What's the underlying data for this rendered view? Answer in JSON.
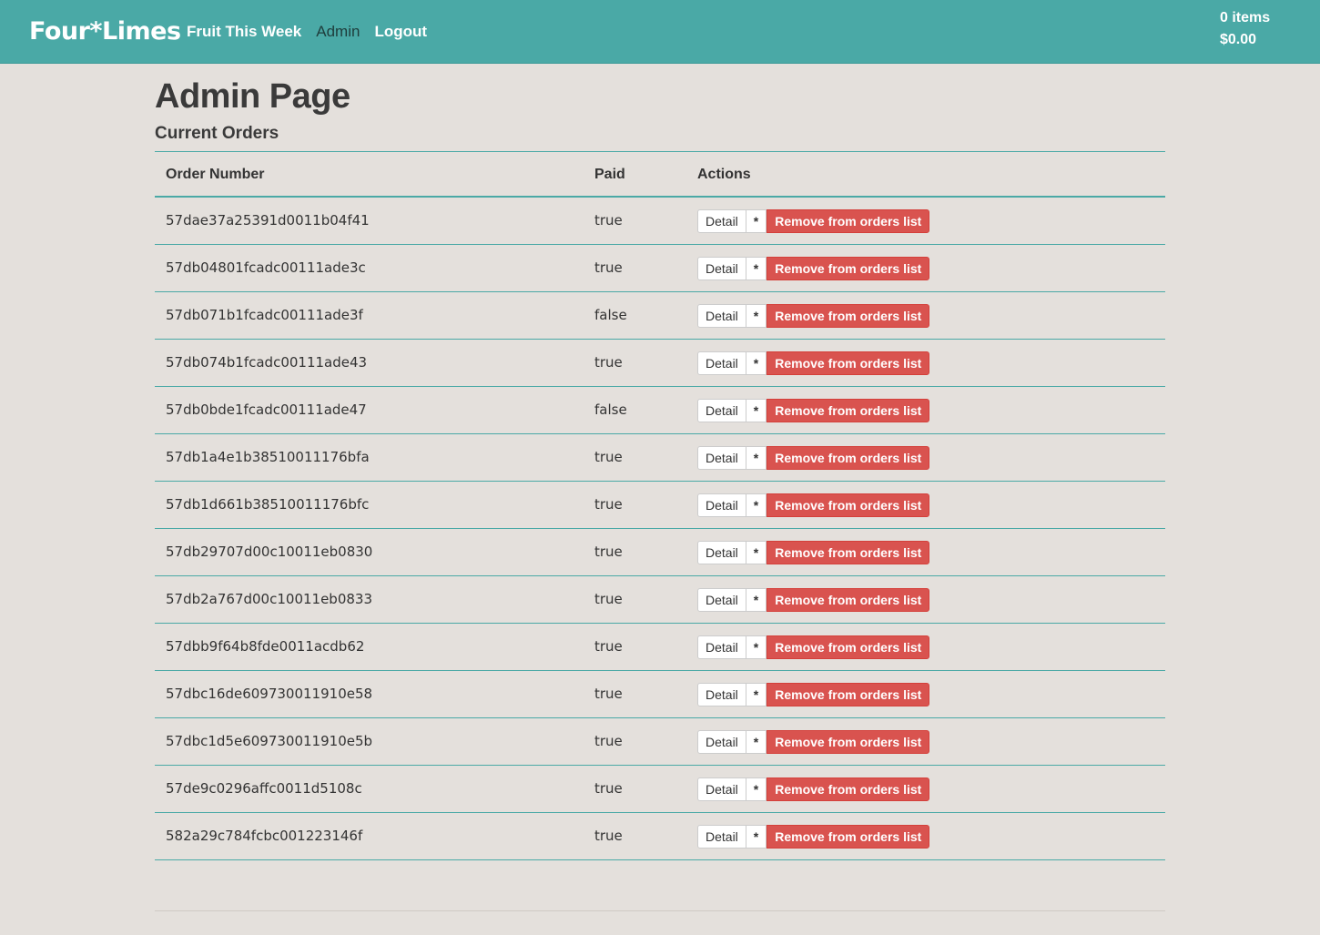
{
  "nav": {
    "brand": "Four*Limes",
    "links": [
      {
        "label": "Fruit This Week"
      },
      {
        "label": "Admin"
      },
      {
        "label": "Logout"
      }
    ],
    "cart_items": "0 items",
    "cart_total": "$0.00"
  },
  "page": {
    "title": "Admin Page",
    "section_title": "Current Orders"
  },
  "table": {
    "headers": {
      "order_number": "Order Number",
      "paid": "Paid",
      "actions": "Actions"
    },
    "detail_label": "Detail",
    "star_label": "*",
    "remove_label": "Remove from orders list",
    "rows": [
      {
        "order": "57dae37a25391d0011b04f41",
        "paid": "true"
      },
      {
        "order": "57db04801fcadc00111ade3c",
        "paid": "true"
      },
      {
        "order": "57db071b1fcadc00111ade3f",
        "paid": "false"
      },
      {
        "order": "57db074b1fcadc00111ade43",
        "paid": "true"
      },
      {
        "order": "57db0bde1fcadc00111ade47",
        "paid": "false"
      },
      {
        "order": "57db1a4e1b38510011176bfa",
        "paid": "true"
      },
      {
        "order": "57db1d661b38510011176bfc",
        "paid": "true"
      },
      {
        "order": "57db29707d00c10011eb0830",
        "paid": "true"
      },
      {
        "order": "57db2a767d00c10011eb0833",
        "paid": "true"
      },
      {
        "order": "57dbb9f64b8fde0011acdb62",
        "paid": "true"
      },
      {
        "order": "57dbc16de609730011910e58",
        "paid": "true"
      },
      {
        "order": "57dbc1d5e609730011910e5b",
        "paid": "true"
      },
      {
        "order": "57de9c0296affc0011d5108c",
        "paid": "true"
      },
      {
        "order": "582a29c784fcbc001223146f",
        "paid": "true"
      }
    ]
  },
  "colors": {
    "navbar": "#4aa9a6",
    "background": "#e4e0dc",
    "danger": "#d9534f"
  }
}
